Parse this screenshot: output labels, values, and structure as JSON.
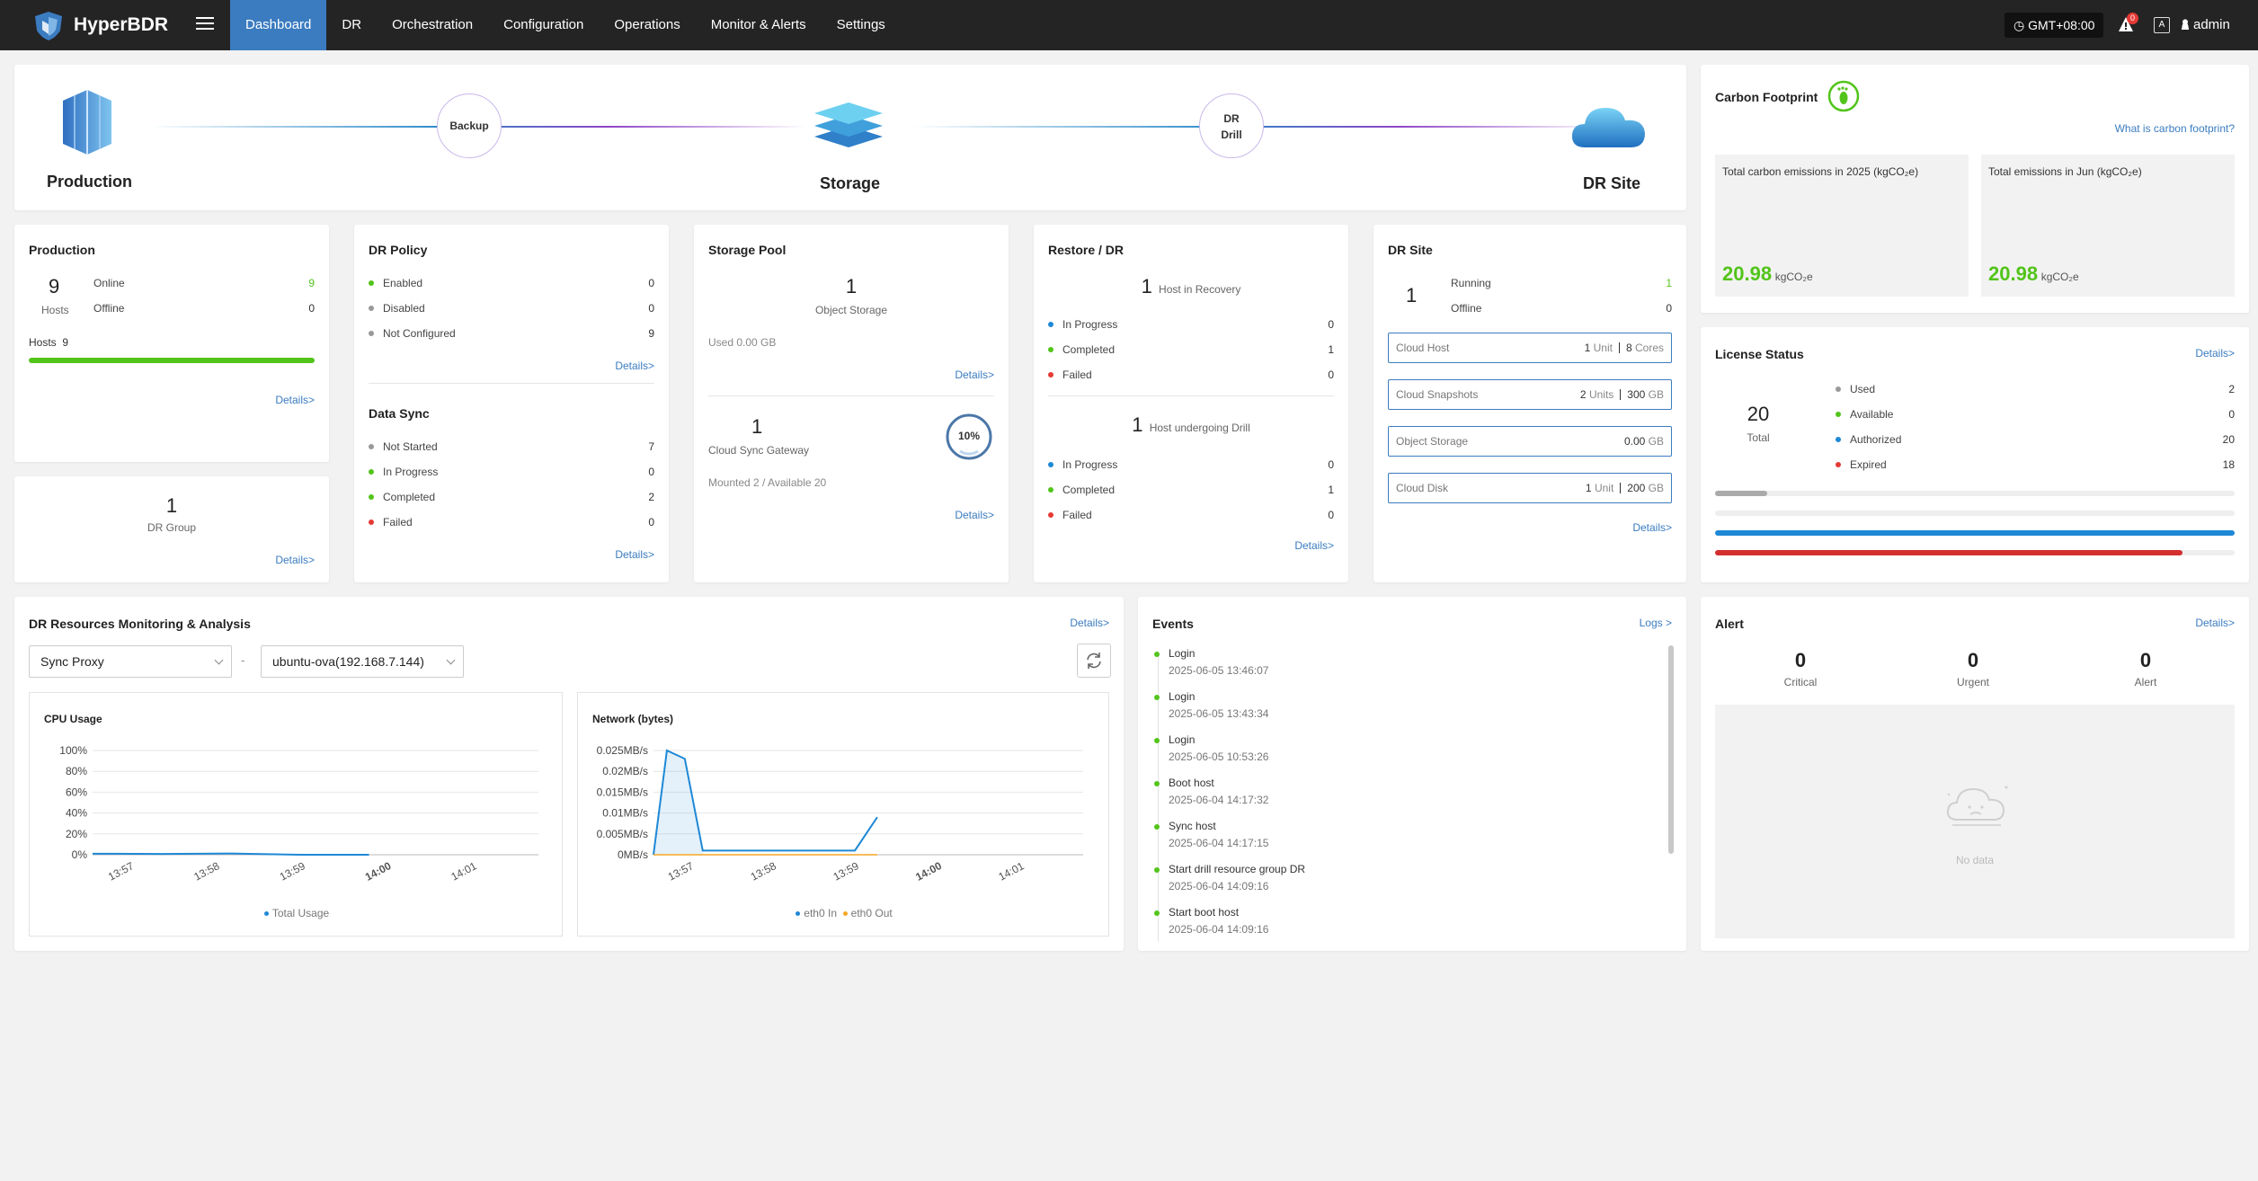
{
  "topbar": {
    "brand": "HyperBDR",
    "nav": [
      "Dashboard",
      "DR",
      "Orchestration",
      "Configuration",
      "Operations",
      "Monitor & Alerts",
      "Settings"
    ],
    "timezone": "GMT+08:00",
    "notifications": "0",
    "lang": "A",
    "user": "admin"
  },
  "flow": {
    "production": "Production",
    "backup": "Backup",
    "storage": "Storage",
    "drill1": "DR",
    "drill2": "Drill",
    "drsite": "DR Site"
  },
  "production": {
    "title": "Production",
    "hosts": "9",
    "hosts_label": "Hosts",
    "online_label": "Online",
    "online": "9",
    "offline_label": "Offline",
    "offline": "0",
    "hosts_bar_label": "Hosts",
    "hosts_bar": "9",
    "details": "Details>"
  },
  "drgroup": {
    "count": "1",
    "label": "DR Group",
    "details": "Details>"
  },
  "drpolicy": {
    "title": "DR Policy",
    "items": [
      {
        "label": "Enabled",
        "value": "0"
      },
      {
        "label": "Disabled",
        "value": "0"
      },
      {
        "label": "Not Configured",
        "value": "9"
      }
    ],
    "details": "Details>"
  },
  "datasync": {
    "title": "Data Sync",
    "items": [
      {
        "label": "Not Started",
        "value": "7"
      },
      {
        "label": "In Progress",
        "value": "0"
      },
      {
        "label": "Completed",
        "value": "2"
      },
      {
        "label": "Failed",
        "value": "0"
      }
    ],
    "details": "Details>"
  },
  "storagepool": {
    "title": "Storage Pool",
    "count": "1",
    "label": "Object Storage",
    "used": "Used 0.00 GB",
    "details": "Details>",
    "gw_count": "1",
    "gw_label": "Cloud Sync Gateway",
    "percent": "10%",
    "percent_value": 0.1,
    "mounted": "Mounted 2 / Available 20",
    "details2": "Details>"
  },
  "restore": {
    "title": "Restore / DR",
    "recovery_count": "1",
    "recovery_label": "Host in Recovery",
    "r_items": [
      {
        "label": "In Progress",
        "value": "0"
      },
      {
        "label": "Completed",
        "value": "1"
      },
      {
        "label": "Failed",
        "value": "0"
      }
    ],
    "drill_count": "1",
    "drill_label": "Host undergoing Drill",
    "d_items": [
      {
        "label": "In Progress",
        "value": "0"
      },
      {
        "label": "Completed",
        "value": "1"
      },
      {
        "label": "Failed",
        "value": "0"
      }
    ],
    "details": "Details>"
  },
  "drsite": {
    "title": "DR Site",
    "count": "1",
    "running_label": "Running",
    "running": "1",
    "offline_label": "Offline",
    "offline": "0",
    "boxes": [
      {
        "label": "Cloud Host",
        "v1": "1",
        "u1": "Unit",
        "v2": "8",
        "u2": "Cores"
      },
      {
        "label": "Cloud Snapshots",
        "v1": "2",
        "u1": "Units",
        "v2": "300",
        "u2": "GB"
      },
      {
        "label": "Object Storage",
        "v1": "0.00",
        "u1": "GB",
        "v2": "",
        "u2": ""
      },
      {
        "label": "Cloud Disk",
        "v1": "1",
        "u1": "Unit",
        "v2": "200",
        "u2": "GB"
      }
    ],
    "details": "Details>"
  },
  "carbon": {
    "title": "Carbon Footprint",
    "link": "What is carbon footprint?",
    "total_label": "Total carbon emissions in 2025 (kgCO₂e)",
    "total": "20.98",
    "unit": "kgCO₂e",
    "month_label": "Total emissions in Jun (kgCO₂e)",
    "month": "20.98"
  },
  "license": {
    "title": "License Status",
    "details": "Details>",
    "total": "20",
    "total_label": "Total",
    "items": [
      {
        "label": "Used",
        "value": "2"
      },
      {
        "label": "Available",
        "value": "0"
      },
      {
        "label": "Authorized",
        "value": "20"
      },
      {
        "label": "Expired",
        "value": "18"
      }
    ],
    "bars": [
      {
        "fraction": 0.1,
        "color": "#aaaaaa"
      },
      {
        "fraction": 0.0,
        "color": "#52c41a"
      },
      {
        "fraction": 1.0,
        "color": "#1e88d6"
      },
      {
        "fraction": 0.9,
        "color": "#d32f2f"
      }
    ]
  },
  "monitor": {
    "title": "DR Resources Monitoring & Analysis",
    "details": "Details>",
    "select1": "Sync Proxy",
    "dash": "-",
    "select2": "ubuntu-ova(192.168.7.144)"
  },
  "cpu_chart": {
    "title": "CPU Usage",
    "legend": "Total Usage",
    "yticks": [
      "100%",
      "80%",
      "60%",
      "40%",
      "20%",
      "0%"
    ],
    "xticks": [
      "13:57",
      "13:58",
      "13:59",
      "14:00",
      "14:01"
    ]
  },
  "net_chart": {
    "title": "Network (bytes)",
    "legend_in": "eth0 In",
    "legend_out": "eth0 Out",
    "yticks": [
      "0.025MB/s",
      "0.02MB/s",
      "0.015MB/s",
      "0.01MB/s",
      "0.005MB/s",
      "0MB/s"
    ],
    "xticks": [
      "13:57",
      "13:58",
      "13:59",
      "14:00",
      "14:01"
    ]
  },
  "chart_data": [
    {
      "type": "line",
      "title": "CPU Usage",
      "ylim": [
        0,
        100
      ],
      "x": [
        "13:57",
        "13:58",
        "13:59",
        "14:00",
        "14:01"
      ],
      "series": [
        {
          "name": "Total Usage",
          "values": [
            1,
            0.8,
            1.2,
            0,
            0
          ],
          "x_span": [
            0,
            0.62
          ]
        }
      ]
    },
    {
      "type": "line",
      "title": "Network (bytes)",
      "ylim": [
        0,
        0.025
      ],
      "x": [
        "13:57",
        "13:58",
        "13:59",
        "14:00",
        "14:01"
      ],
      "series": [
        {
          "name": "eth0 In",
          "values": [
            0,
            0.025,
            0.023,
            0.001,
            0.001,
            0.001,
            0.001,
            0.001,
            0.009
          ]
        },
        {
          "name": "eth0 Out",
          "values": [
            0,
            0,
            0,
            0,
            0,
            0,
            0,
            0,
            0
          ]
        }
      ]
    }
  ],
  "events": {
    "title": "Events",
    "logs": "Logs >",
    "items": [
      {
        "name": "Login",
        "time": "2025-06-05 13:46:07"
      },
      {
        "name": "Login",
        "time": "2025-06-05 13:43:34"
      },
      {
        "name": "Login",
        "time": "2025-06-05 10:53:26"
      },
      {
        "name": "Boot host",
        "time": "2025-06-04 14:17:32"
      },
      {
        "name": "Sync host",
        "time": "2025-06-04 14:17:15"
      },
      {
        "name": "Start drill resource group DR",
        "time": "2025-06-04 14:09:16"
      },
      {
        "name": "Start boot host",
        "time": "2025-06-04 14:09:16"
      }
    ]
  },
  "alert": {
    "title": "Alert",
    "details": "Details>",
    "critical": "0",
    "critical_label": "Critical",
    "urgent": "0",
    "urgent_label": "Urgent",
    "alert": "0",
    "alert_label": "Alert",
    "nodata": "No data"
  },
  "colors": {
    "accent": "#3b7cc0",
    "green": "#52c41a",
    "blue": "#1e88d6",
    "red": "#e53935"
  }
}
